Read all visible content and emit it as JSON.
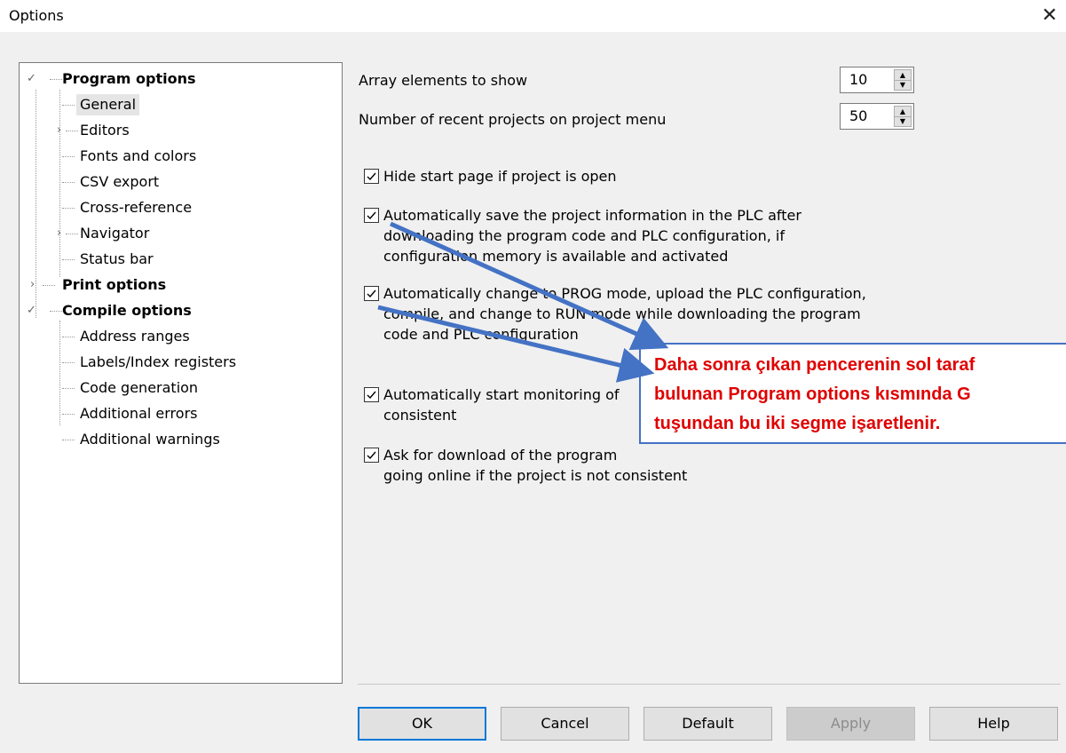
{
  "window": {
    "title": "Options",
    "close_glyph": "✕"
  },
  "tree": {
    "items": [
      {
        "label": "Program options",
        "bold": true,
        "expander": "expanded"
      },
      {
        "label": "General",
        "selected": true
      },
      {
        "label": "Editors",
        "expander": "collapsed"
      },
      {
        "label": "Fonts and colors"
      },
      {
        "label": "CSV export"
      },
      {
        "label": "Cross-reference"
      },
      {
        "label": "Navigator",
        "expander": "collapsed"
      },
      {
        "label": "Status bar"
      },
      {
        "label": "Print options",
        "bold": true,
        "expander": "collapsed"
      },
      {
        "label": "Compile options",
        "bold": true,
        "expander": "expanded"
      },
      {
        "label": "Address ranges"
      },
      {
        "label": "Labels/Index registers"
      },
      {
        "label": "Code generation"
      },
      {
        "label": "Additional errors"
      },
      {
        "label": "Additional warnings"
      }
    ]
  },
  "settings": {
    "array_elements": {
      "label": "Array elements to show",
      "value": "10"
    },
    "recent_projects": {
      "label": "Number of recent projects on project menu",
      "value": "50"
    },
    "checkboxes": [
      {
        "lines": [
          "Hide start page if project is open"
        ],
        "checked": true
      },
      {
        "lines": [
          "Automatically save the project information in the PLC after",
          "downloading the program code and PLC configuration, if",
          "configuration memory is available and activated"
        ],
        "checked": true
      },
      {
        "lines": [
          "Automatically change to PROG mode, upload the PLC configuration,",
          "compile, and change to RUN mode while downloading the program",
          "code and PLC configuration"
        ],
        "checked": true
      },
      {
        "lines": [
          "Automatically start monitoring of",
          "consistent"
        ],
        "checked": true
      },
      {
        "lines": [
          "Ask for download of the program",
          "going online if the project is not consistent"
        ],
        "checked": true
      }
    ]
  },
  "buttons": {
    "ok": "OK",
    "cancel": "Cancel",
    "default": "Default",
    "apply": "Apply",
    "help": "Help"
  },
  "callout": {
    "lines": [
      "Daha sonra çıkan pencerenin sol taraf",
      "bulunan Program options kısmında G",
      "tuşundan bu iki segme işaretlenir."
    ],
    "text_color": "#e00000",
    "border_color": "#4472c4"
  },
  "colors": {
    "arrow": "#4472c4",
    "focus": "#0078d7"
  }
}
